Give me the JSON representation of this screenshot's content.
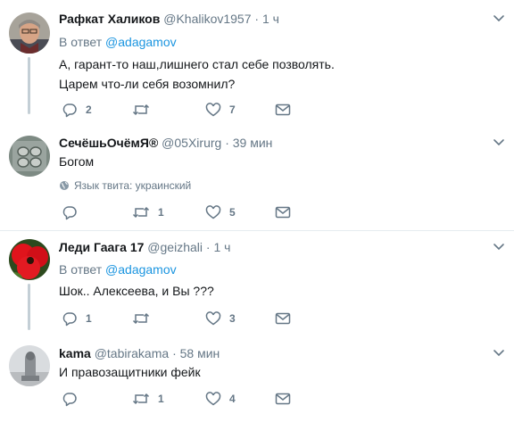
{
  "tweets": [
    {
      "name": "Рафкат Халиков",
      "handle": "@Khalikov1957",
      "dot": "·",
      "time": "1 ч",
      "reply_prefix": "В ответ",
      "reply_to": "@adagamov",
      "text_lines": [
        "А, гарант-то наш,лишнего стал себе позволять.",
        "Царем что-ли себя возомнил?"
      ],
      "replies": "2",
      "retweets": "",
      "likes": "7"
    },
    {
      "name": "СечёшьОчёмЯ®",
      "handle": "@05Xirurg",
      "dot": "·",
      "time": "39 мин",
      "text_lines": [
        "Богом"
      ],
      "language_note": "Язык твита: украинский",
      "replies": "",
      "retweets": "1",
      "likes": "5"
    },
    {
      "name": "Леди Гаага 17",
      "handle": "@geizhali",
      "dot": "·",
      "time": "1 ч",
      "reply_prefix": "В ответ",
      "reply_to": "@adagamov",
      "text_lines": [
        "Шок.. Алексеева, и Вы ???"
      ],
      "replies": "1",
      "retweets": "",
      "likes": "3"
    },
    {
      "name": "kama",
      "handle": "@tabirakama",
      "dot": "·",
      "time": "58 мин",
      "text_lines": [
        "И правозащитники фейк"
      ],
      "replies": "",
      "retweets": "1",
      "likes": "4"
    }
  ],
  "icons": {
    "reply": "reply-icon",
    "retweet": "retweet-icon",
    "like": "heart-icon",
    "dm": "envelope-icon",
    "caret": "chevron-down-icon",
    "globe": "globe-icon"
  },
  "colors": {
    "name": "#14171a",
    "secondary": "#657786",
    "link": "#1b95e0",
    "thread_line": "#c4cfd6",
    "divider": "#e6ecf0"
  }
}
